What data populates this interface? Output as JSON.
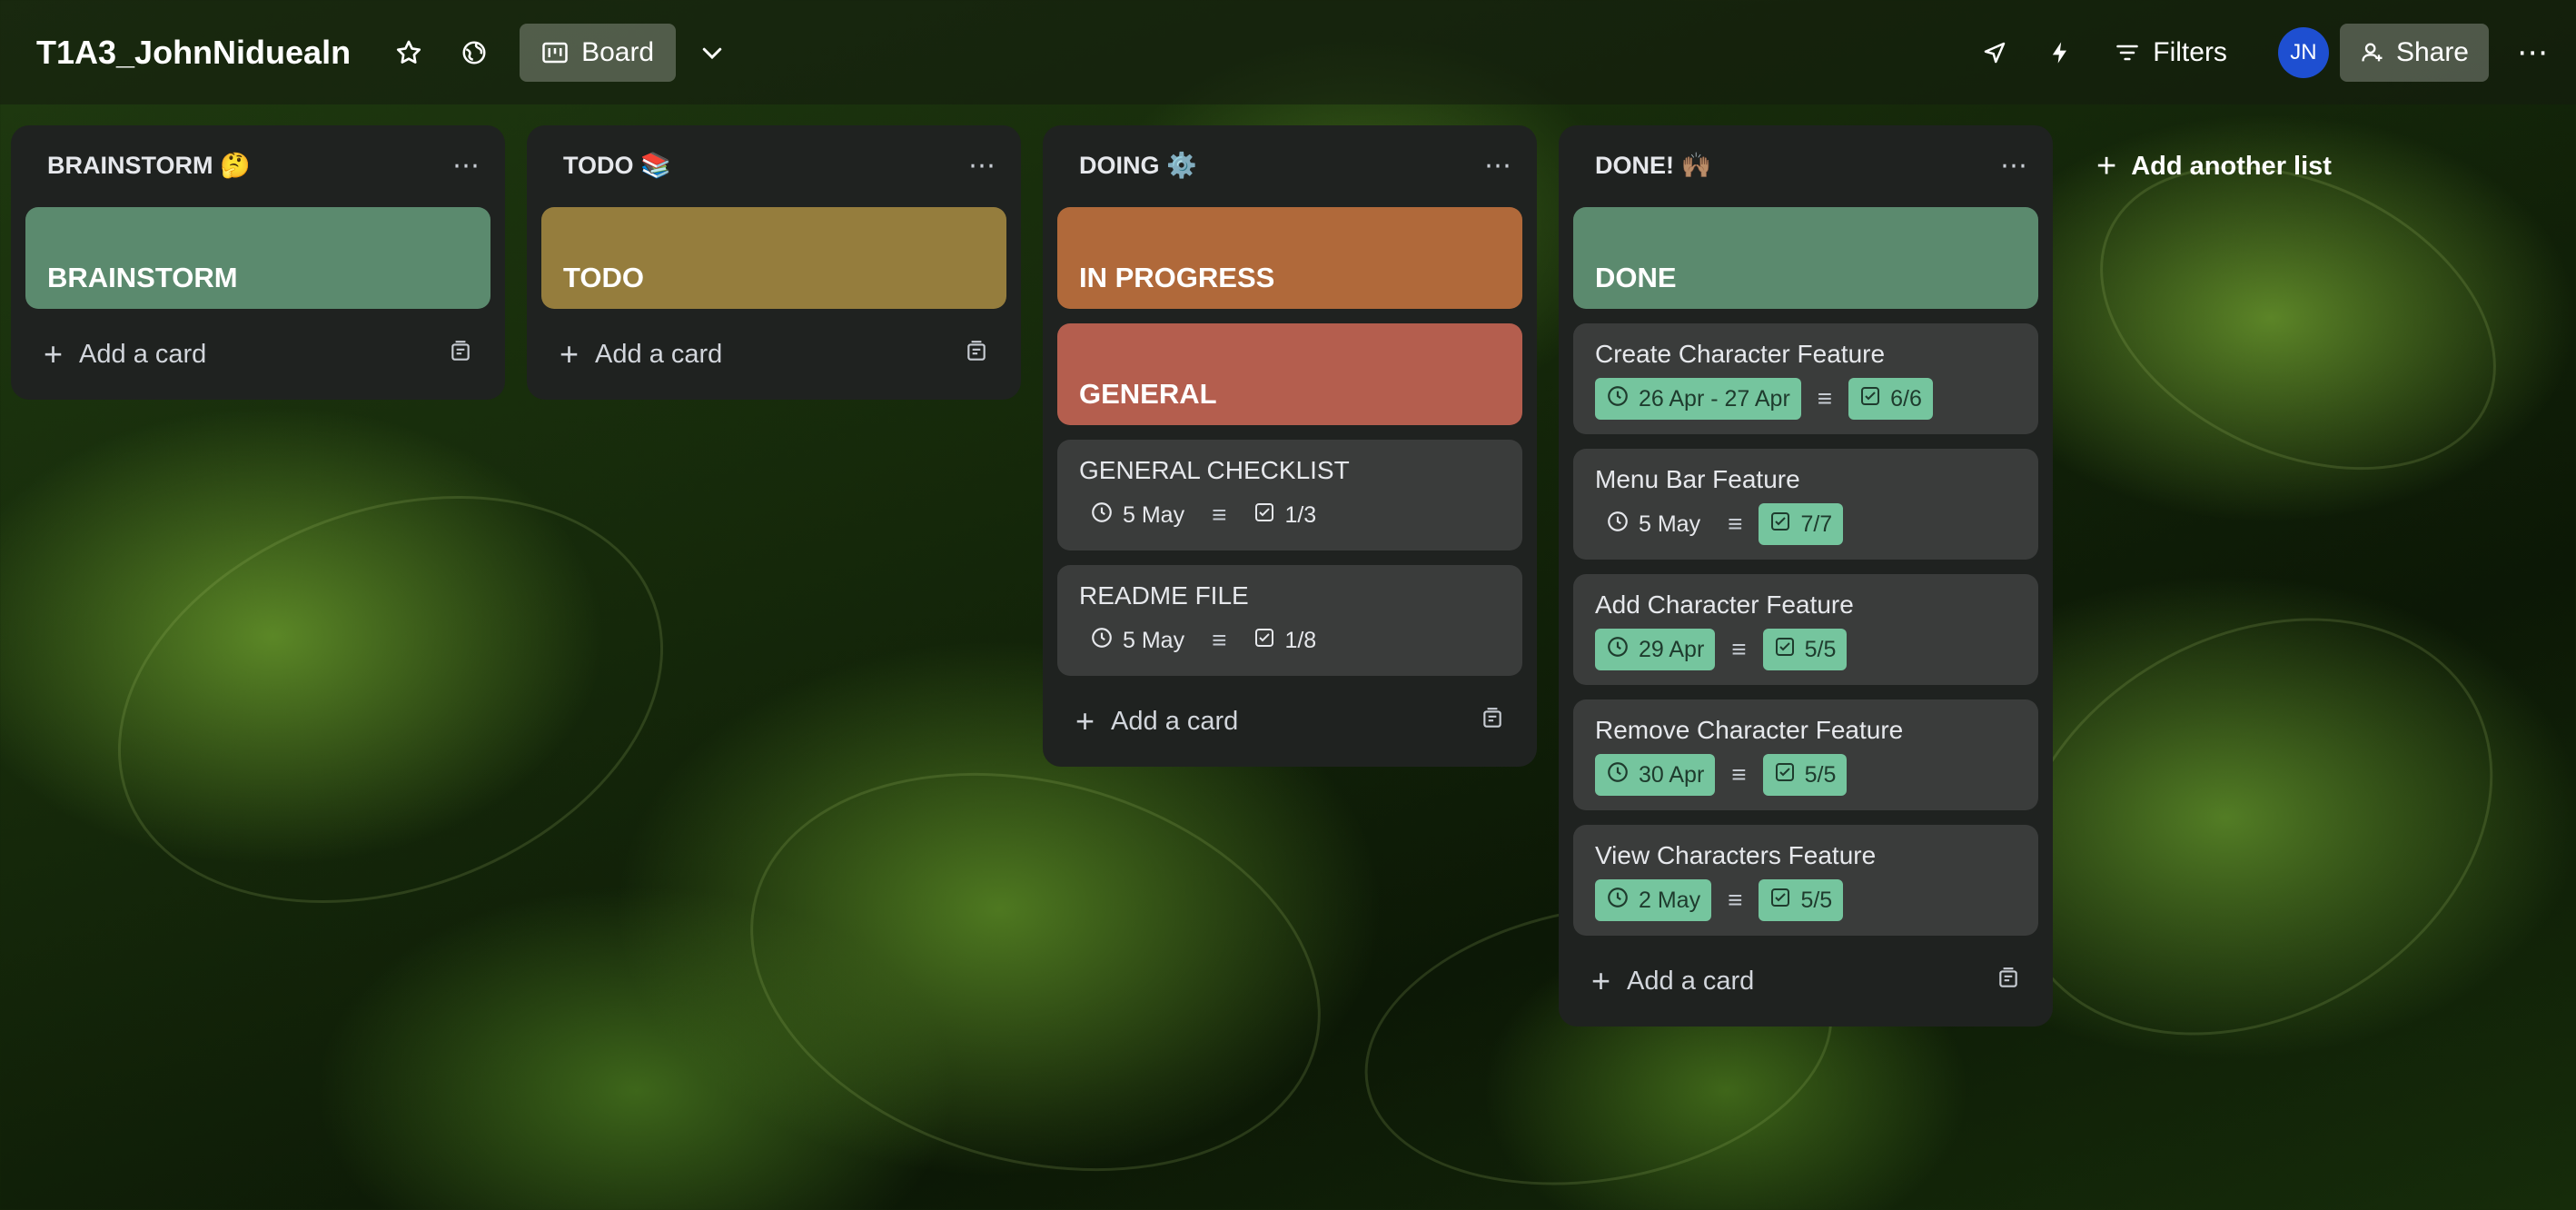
{
  "header": {
    "board_title": "T1A3_JohnNiduealn",
    "view_label": "Board",
    "filters_label": "Filters",
    "avatar_initials": "JN",
    "share_label": "Share"
  },
  "lists": [
    {
      "title": "BRAINSTORM 🤔",
      "cover": {
        "label": "BRAINSTORM",
        "color": "#5b8a6e"
      },
      "add_card": "Add a card"
    },
    {
      "title": "TODO 📚",
      "cover": {
        "label": "TODO",
        "color": "#957d3d"
      },
      "add_card": "Add a card"
    },
    {
      "title": "DOING ⚙️",
      "covers": [
        {
          "label": "IN PROGRESS",
          "color": "#b0693a"
        },
        {
          "label": "GENERAL",
          "color": "#b45e4e"
        }
      ],
      "cards": [
        {
          "title": "GENERAL CHECKLIST",
          "date": "5 May",
          "checklist": "1/3"
        },
        {
          "title": "README FILE",
          "date": "5 May",
          "checklist": "1/8"
        }
      ],
      "add_card": "Add a card"
    },
    {
      "title": "DONE! 🙌🏽",
      "cover": {
        "label": "DONE",
        "color": "#5b8a6e"
      },
      "cards": [
        {
          "title": "Create Character Feature",
          "date": "26 Apr - 27 Apr",
          "date_done": true,
          "checklist": "6/6"
        },
        {
          "title": "Menu Bar Feature",
          "date": "5 May",
          "date_done": false,
          "checklist": "7/7"
        },
        {
          "title": "Add Character Feature",
          "date": "29 Apr",
          "date_done": true,
          "checklist": "5/5"
        },
        {
          "title": "Remove Character Feature",
          "date": "30 Apr",
          "date_done": true,
          "checklist": "5/5"
        },
        {
          "title": "View Characters Feature",
          "date": "2 May",
          "date_done": true,
          "checklist": "5/5"
        }
      ],
      "add_card": "Add a card"
    }
  ],
  "add_list_label": "Add another list",
  "colors": {
    "badge_done": "#75c59e",
    "list_bg": "#1f2220",
    "card_bg": "#3a3c3b"
  }
}
